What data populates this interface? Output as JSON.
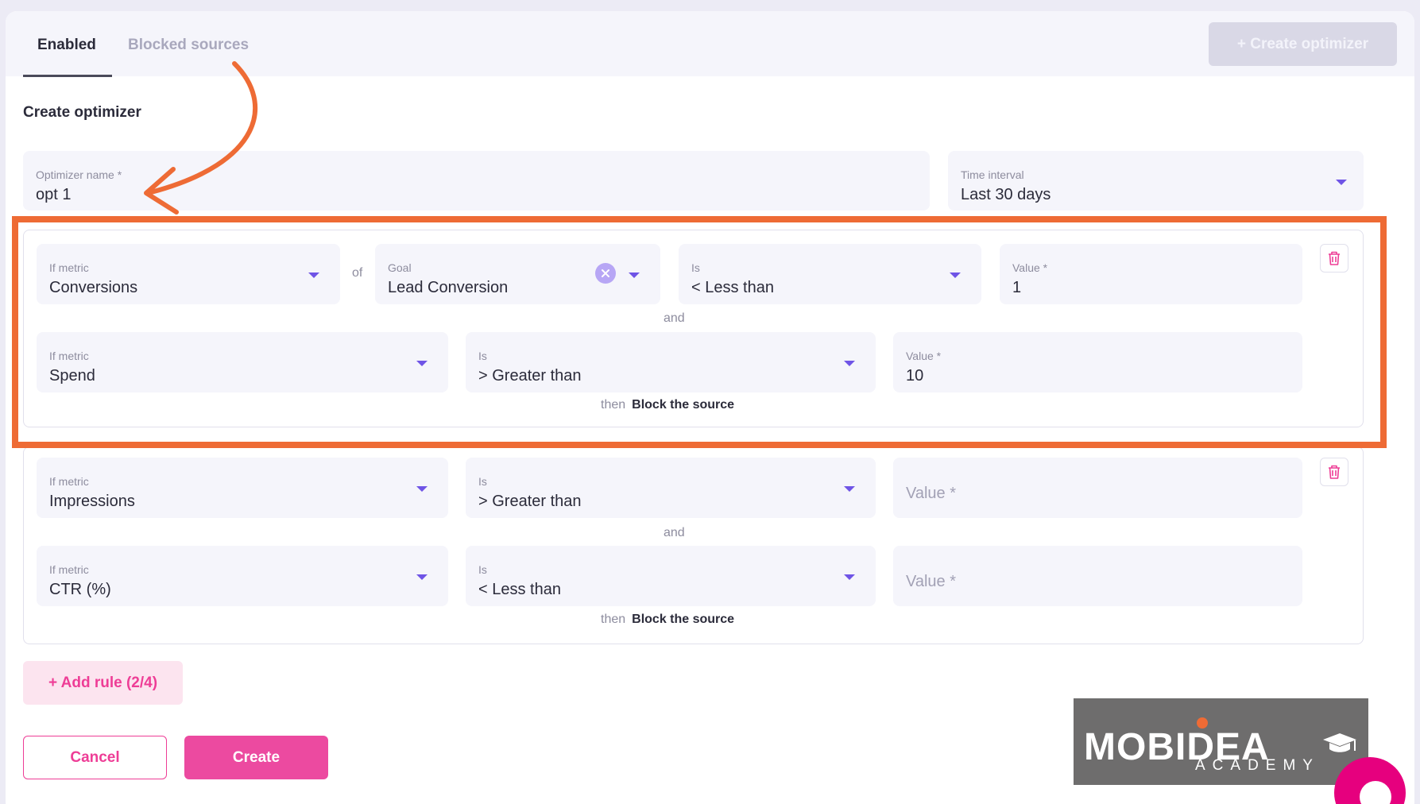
{
  "tabs": [
    {
      "label": "Enabled",
      "active": true
    },
    {
      "label": "Blocked sources",
      "active": false
    }
  ],
  "header": {
    "create_button": "+ Create optimizer"
  },
  "form": {
    "title": "Create optimizer",
    "name": {
      "label": "Optimizer name *",
      "value": "opt 1"
    },
    "interval": {
      "label": "Time interval",
      "value": "Last 30 days"
    }
  },
  "rules": [
    {
      "row1": {
        "metric": {
          "label": "If metric",
          "value": "Conversions"
        },
        "of_text": "of",
        "goal": {
          "label": "Goal",
          "value": "Lead Conversion"
        },
        "is": {
          "label": "Is",
          "value": "< Less than"
        },
        "value": {
          "label": "Value *",
          "value": "1"
        }
      },
      "connector": "and",
      "row2": {
        "metric": {
          "label": "If metric",
          "value": "Spend"
        },
        "is": {
          "label": "Is",
          "value": "> Greater than"
        },
        "value": {
          "label": "Value *",
          "value": "10"
        }
      },
      "then": "then",
      "action": "Block the source"
    },
    {
      "row1": {
        "metric": {
          "label": "If metric",
          "value": "Impressions"
        },
        "is": {
          "label": "Is",
          "value": "> Greater than"
        },
        "value": {
          "placeholder": "Value *"
        }
      },
      "connector": "and",
      "row2": {
        "metric": {
          "label": "If metric",
          "value": "CTR (%)"
        },
        "is": {
          "label": "Is",
          "value": "< Less than"
        },
        "value": {
          "placeholder": "Value *"
        }
      },
      "then": "then",
      "action": "Block the source"
    }
  ],
  "buttons": {
    "add_rule": "+ Add rule (2/4)",
    "cancel": "Cancel",
    "create": "Create"
  },
  "logo": {
    "word": "MOBIDEA",
    "sub": "ACADEMY"
  },
  "colors": {
    "accent": "#ec4aa0",
    "highlight": "#ee6b35",
    "caret": "#6f54e6"
  }
}
